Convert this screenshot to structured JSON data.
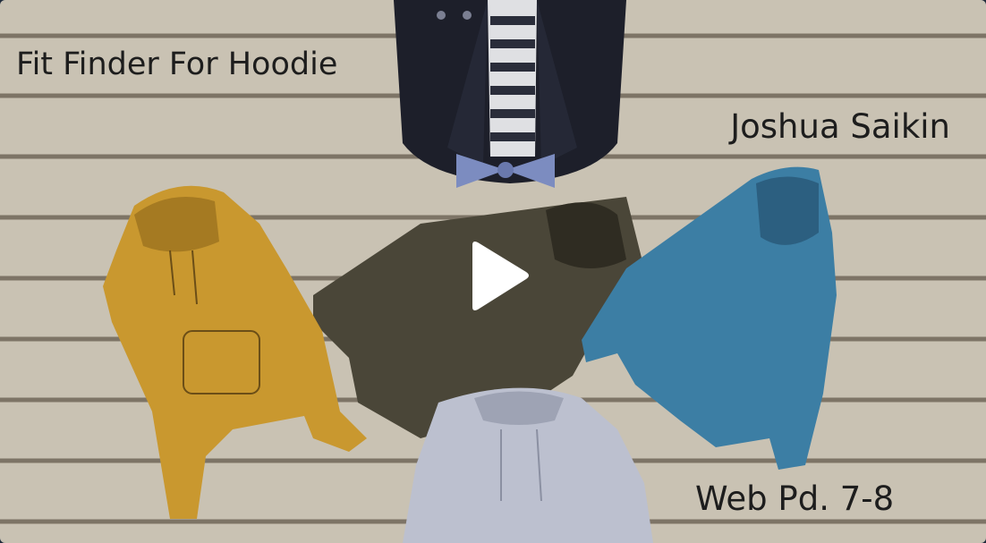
{
  "video": {
    "title": "Fit Finder For Hoodie",
    "author": "Joshua Saikin",
    "period": "Web Pd. 7-8",
    "play_icon": "play-icon"
  },
  "colors": {
    "wall": "#c9c2b3",
    "stripe": "#7d7466",
    "yellow_hoodie": "#c9982f",
    "olive_hoodie": "#4a4638",
    "blue_hoodie": "#3c7ea4",
    "grey_hoodie": "#bcc0cf",
    "blazer": "#1d1f2a"
  }
}
